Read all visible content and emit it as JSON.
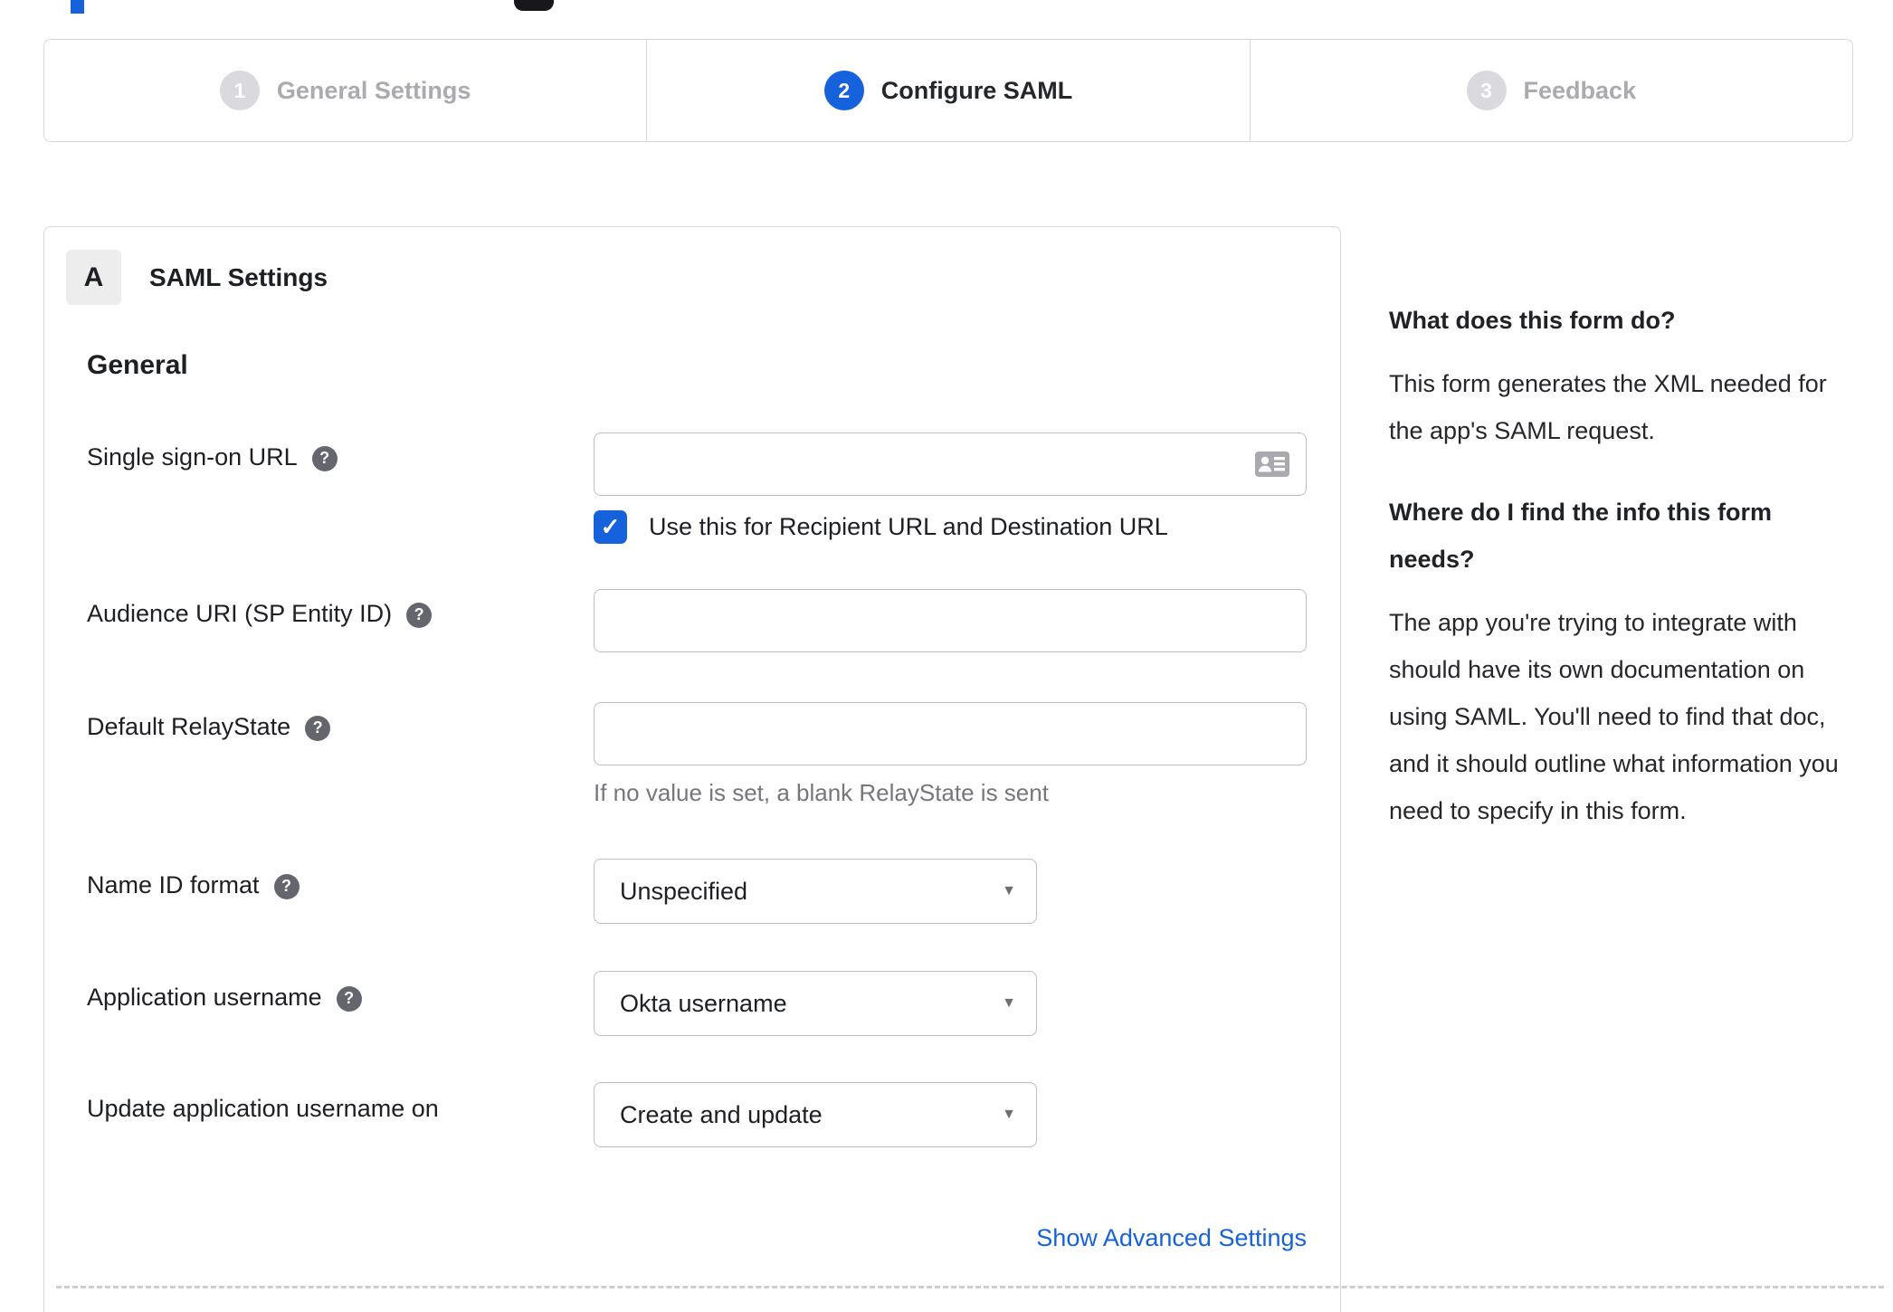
{
  "stepper": {
    "steps": [
      {
        "number": "1",
        "label": "General Settings"
      },
      {
        "number": "2",
        "label": "Configure SAML"
      },
      {
        "number": "3",
        "label": "Feedback"
      }
    ],
    "active_step": "Configure SAML"
  },
  "panel": {
    "badge": "A",
    "title": "SAML Settings",
    "section_heading": "General",
    "rows": {
      "sso_url": {
        "label": "Single sign-on URL",
        "value": "",
        "placeholder": "",
        "checkbox_label": "Use this for Recipient URL and Destination URL",
        "checkbox_checked": true
      },
      "audience_uri": {
        "label": "Audience URI (SP Entity ID)",
        "value": "",
        "placeholder": ""
      },
      "relay_state": {
        "label": "Default RelayState",
        "value": "",
        "placeholder": "",
        "helper": "If no value is set, a blank RelayState is sent"
      },
      "name_id_format": {
        "label": "Name ID format",
        "value": "Unspecified"
      },
      "app_username": {
        "label": "Application username",
        "value": "Okta username"
      },
      "update_username": {
        "label": "Update application username on",
        "value": "Create and update"
      }
    },
    "advanced_link": "Show Advanced Settings"
  },
  "sidebar": {
    "sections": [
      {
        "heading": "What does this form do?",
        "body": "This form generates the XML needed for the app's SAML request."
      },
      {
        "heading": "Where do I find the info this form needs?",
        "body": "The app you're trying to integrate with should have its own documentation on using SAML. You'll need to find that doc, and it should outline what information you need to specify in this form."
      }
    ]
  },
  "icons": {
    "help_glyph": "?",
    "caret_glyph": "▼",
    "check_glyph": "✓",
    "contact_card": "contact-card-icon"
  },
  "colors": {
    "accent_blue": "#1662dd",
    "inactive_gray": "#d9d9de",
    "border_gray": "#d8d8dc",
    "text_dark": "#1d1f24",
    "muted_text": "#77767e"
  }
}
